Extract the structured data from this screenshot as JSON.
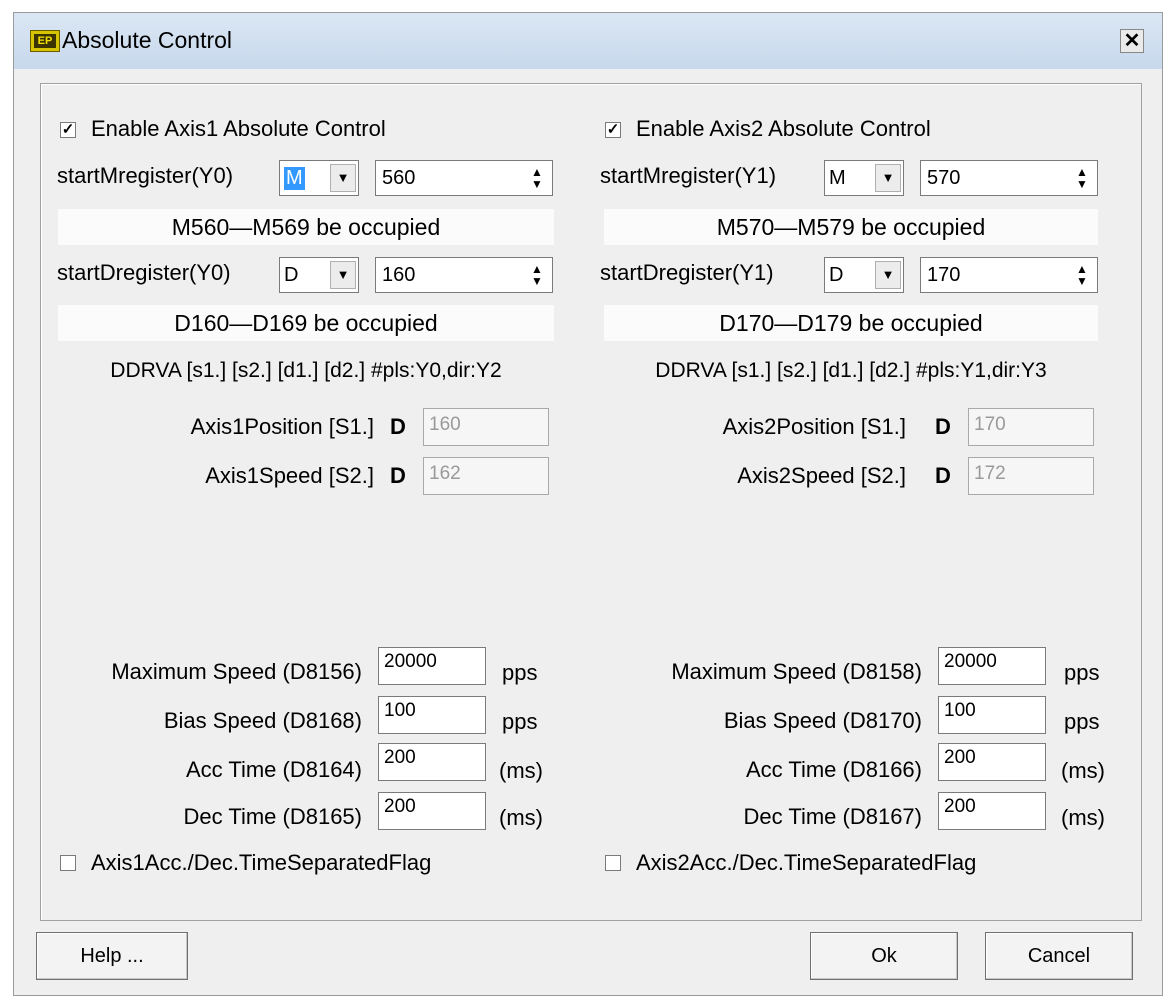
{
  "window": {
    "title": "Absolute Control",
    "app_icon_text": "EP",
    "close_glyph": "✕"
  },
  "axis1": {
    "enable_label": "Enable Axis1 Absolute Control",
    "enable_checked": true,
    "m_label": "startMregister(Y0)",
    "m_type": "M",
    "m_value": "560",
    "m_info": "M560—M569 be occupied",
    "d_label": "startDregister(Y0)",
    "d_type": "D",
    "d_value": "160",
    "d_info": "D160—D169 be occupied",
    "instruction": "DDRVA [s1.] [s2.] [d1.] [d2.] #pls:Y0,dir:Y2",
    "position_label": "Axis1Position [S1.]",
    "position_prefix": "D",
    "position_value": "160",
    "speed_label": "Axis1Speed [S2.]",
    "speed_prefix": "D",
    "speed_value": "162",
    "max_speed_label": "Maximum Speed (D8156)",
    "max_speed_value": "20000",
    "max_speed_unit": "pps",
    "bias_speed_label": "Bias Speed (D8168)",
    "bias_speed_value": "100",
    "bias_speed_unit": "pps",
    "acc_label": "Acc Time (D8164)",
    "acc_value": "200",
    "acc_unit": "(ms)",
    "dec_label": "Dec Time (D8165)",
    "dec_value": "200",
    "dec_unit": "(ms)",
    "sep_flag_label": "Axis1Acc./Dec.TimeSeparatedFlag",
    "sep_flag_checked": false
  },
  "axis2": {
    "enable_label": "Enable Axis2 Absolute Control",
    "enable_checked": true,
    "m_label": "startMregister(Y1)",
    "m_type": "M",
    "m_value": "570",
    "m_info": "M570—M579 be occupied",
    "d_label": "startDregister(Y1)",
    "d_type": "D",
    "d_value": "170",
    "d_info": "D170—D179 be occupied",
    "instruction": "DDRVA [s1.] [s2.] [d1.] [d2.] #pls:Y1,dir:Y3",
    "position_label": "Axis2Position [S1.]",
    "position_prefix": "D",
    "position_value": "170",
    "speed_label": "Axis2Speed [S2.]",
    "speed_prefix": "D",
    "speed_value": "172",
    "max_speed_label": "Maximum Speed (D8158)",
    "max_speed_value": "20000",
    "max_speed_unit": "pps",
    "bias_speed_label": "Bias Speed (D8170)",
    "bias_speed_value": "100",
    "bias_speed_unit": "pps",
    "acc_label": "Acc Time (D8166)",
    "acc_value": "200",
    "acc_unit": "(ms)",
    "dec_label": "Dec Time (D8167)",
    "dec_value": "200",
    "dec_unit": "(ms)",
    "sep_flag_label": "Axis2Acc./Dec.TimeSeparatedFlag",
    "sep_flag_checked": false
  },
  "buttons": {
    "help": "Help ...",
    "ok": "Ok",
    "cancel": "Cancel"
  },
  "glyphs": {
    "check": "✓",
    "dropdown": "▼",
    "spin_up": "▲",
    "spin_down": "▼"
  },
  "colors": {
    "selection": "#3399ff",
    "dialog_bg": "#f0eff0",
    "titlebar": "#c7d8ec"
  }
}
